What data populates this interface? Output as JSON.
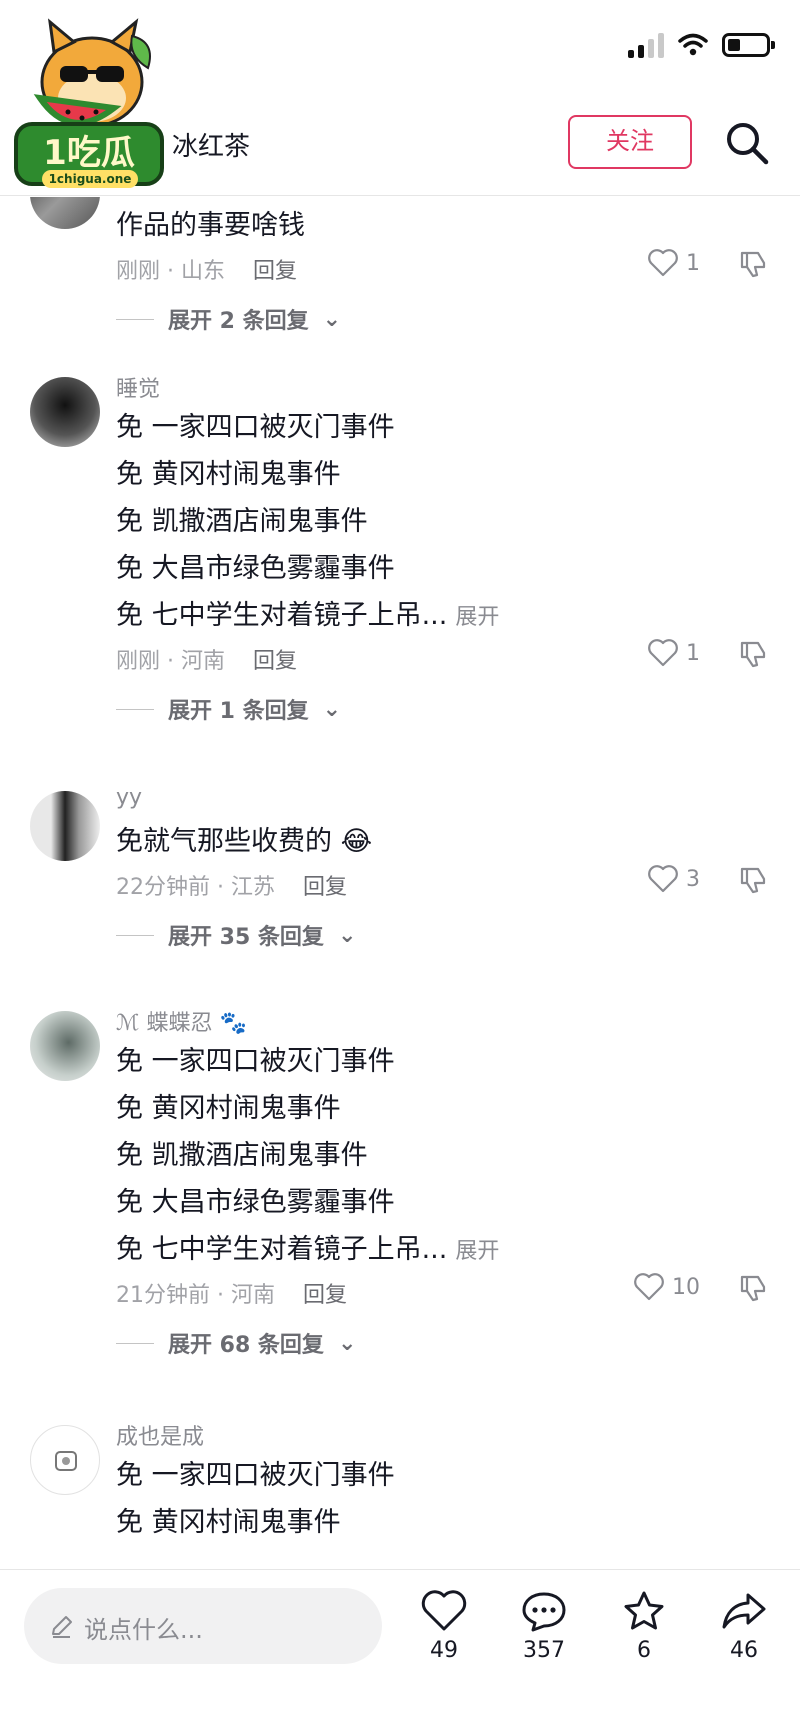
{
  "header": {
    "title": "冰红茶",
    "follow_label": "关注",
    "logo_text": "1吃瓜",
    "logo_domain": "1chigua.one"
  },
  "comments": [
    {
      "username": "",
      "lines": [
        "作品的事要啥钱"
      ],
      "meta": "刚刚 · 山东",
      "reply_label": "回复",
      "likes": "1",
      "more_replies": "展开 2 条回复"
    },
    {
      "username": "睡觉",
      "lines": [
        "免 一家四口被灭门事件",
        "免 黄冈村闹鬼事件",
        "免 凯撒酒店闹鬼事件",
        "免 大昌市绿色雾霾事件",
        "免 七中学生对着镜子上吊..."
      ],
      "expand_label": "展开",
      "meta": "刚刚 · 河南",
      "reply_label": "回复",
      "likes": "1",
      "more_replies": "展开 1 条回复"
    },
    {
      "username": "yy",
      "lines": [
        "免就气那些收费的 😂"
      ],
      "meta": "22分钟前 · 江苏",
      "reply_label": "回复",
      "likes": "3",
      "more_replies": "展开 35 条回复"
    },
    {
      "username": "ℳ 蝶蝶忍 🐾",
      "lines": [
        "免 一家四口被灭门事件",
        "免 黄冈村闹鬼事件",
        "免 凯撒酒店闹鬼事件",
        "免 大昌市绿色雾霾事件",
        "免 七中学生对着镜子上吊..."
      ],
      "expand_label": "展开",
      "meta": "21分钟前 · 河南",
      "reply_label": "回复",
      "likes": "10",
      "more_replies": "展开 68 条回复"
    },
    {
      "username": "成也是成",
      "lines": [
        "免 一家四口被灭门事件",
        "免 黄冈村闹鬼事件"
      ]
    }
  ],
  "bottom": {
    "placeholder": "说点什么...",
    "likes": "49",
    "comments": "357",
    "favorites": "6",
    "shares": "46"
  },
  "colors": {
    "accent": "#e03862",
    "text": "#161823",
    "muted": "#8a8b91"
  }
}
